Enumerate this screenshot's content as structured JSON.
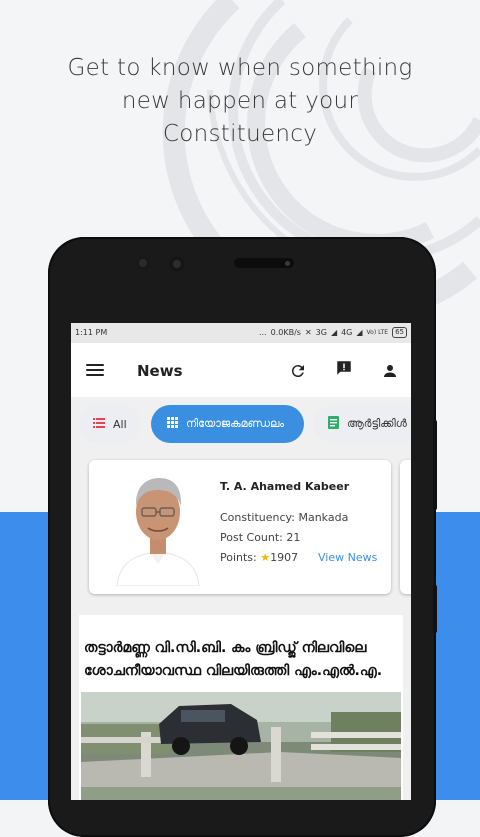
{
  "promo": {
    "headline_lines": [
      "Get to know when something",
      "new happen at your",
      "Constituency"
    ]
  },
  "colors": {
    "accent_blue": "#3d8ded",
    "chip_active": "#3b8fe0",
    "link": "#3b8fe0",
    "background": "#f4f5f7"
  },
  "statusbar": {
    "time": "1:11 PM",
    "dots": "...",
    "net_speed": "0.0KB/s",
    "signal_3g": "3G",
    "signal_4g": "4G",
    "volte": "Vo) LTE",
    "battery": "65"
  },
  "appbar": {
    "title": "News",
    "icons": [
      "menu-icon",
      "refresh-icon",
      "feedback-icon",
      "account-icon"
    ]
  },
  "chips": [
    {
      "label": "All",
      "icon": "list-icon",
      "active": false
    },
    {
      "label": "നിയോജകമണ്ഡലം",
      "icon": "grid-icon",
      "active": true
    },
    {
      "label": "ആർട്ടിക്കിൾ",
      "icon": "article-icon",
      "active": false
    }
  ],
  "mla": {
    "name": "T. A. Ahamed Kabeer",
    "constituency": "Constituency: Mankada",
    "post_count": "Post Count: 21",
    "points_label": "Points:",
    "points_value": "1907",
    "view_news": "View News"
  },
  "news": {
    "title": "തട്ടാർമണ്ണ വി.സി.ബി. കം ബ്രിഡ്ജ് നിലവിലെ ശോചനീയാവസ്ഥ വിലയിരുത്തി എം.എൽ.എ."
  }
}
